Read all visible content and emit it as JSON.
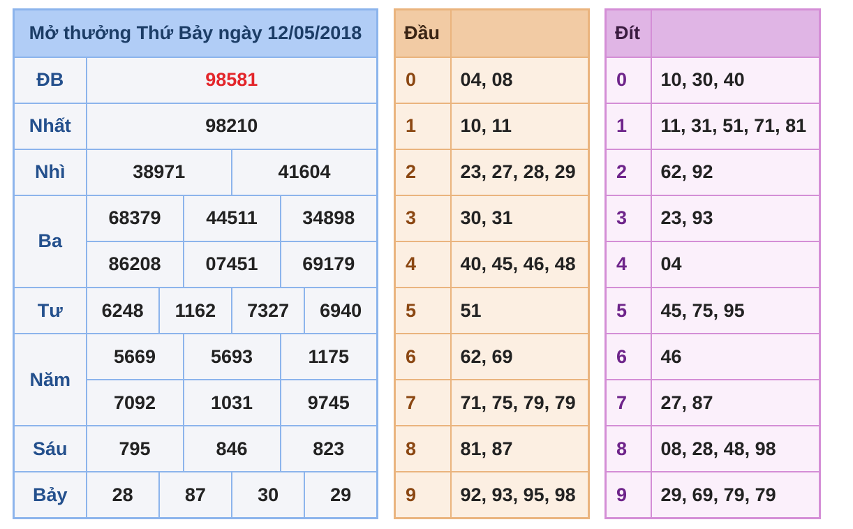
{
  "results": {
    "title": "Mở thưởng Thứ Bảy ngày 12/05/2018",
    "colors": {
      "accent_border": "#8cb4ec",
      "special_prize": "#e3262b",
      "label": "#24508d"
    },
    "rows": [
      {
        "label": "ĐB",
        "values": [
          "98581"
        ]
      },
      {
        "label": "Nhất",
        "values": [
          "98210"
        ]
      },
      {
        "label": "Nhì",
        "values": [
          "38971",
          "41604"
        ]
      },
      {
        "label": "Ba",
        "values": [
          "68379",
          "44511",
          "34898",
          "86208",
          "07451",
          "69179"
        ]
      },
      {
        "label": "Tư",
        "values": [
          "6248",
          "1162",
          "7327",
          "6940"
        ]
      },
      {
        "label": "Năm",
        "values": [
          "5669",
          "5693",
          "1175",
          "7092",
          "1031",
          "9745"
        ]
      },
      {
        "label": "Sáu",
        "values": [
          "795",
          "846",
          "823"
        ]
      },
      {
        "label": "Bảy",
        "values": [
          "28",
          "87",
          "30",
          "29"
        ]
      }
    ]
  },
  "dau": {
    "header": "Đầu",
    "rows": [
      {
        "key": "0",
        "values": "04, 08"
      },
      {
        "key": "1",
        "values": "10, 11"
      },
      {
        "key": "2",
        "values": "23, 27, 28, 29"
      },
      {
        "key": "3",
        "values": "30, 31"
      },
      {
        "key": "4",
        "values": "40, 45, 46, 48"
      },
      {
        "key": "5",
        "values": "51"
      },
      {
        "key": "6",
        "values": "62, 69"
      },
      {
        "key": "7",
        "values": "71, 75, 79, 79"
      },
      {
        "key": "8",
        "values": "81, 87"
      },
      {
        "key": "9",
        "values": "92, 93, 95, 98"
      }
    ]
  },
  "dit": {
    "header": "Đít",
    "rows": [
      {
        "key": "0",
        "values": "10, 30, 40"
      },
      {
        "key": "1",
        "values": "11, 31, 51, 71, 81"
      },
      {
        "key": "2",
        "values": "62, 92"
      },
      {
        "key": "3",
        "values": "23, 93"
      },
      {
        "key": "4",
        "values": "04"
      },
      {
        "key": "5",
        "values": "45, 75, 95"
      },
      {
        "key": "6",
        "values": "46"
      },
      {
        "key": "7",
        "values": "27, 87"
      },
      {
        "key": "8",
        "values": "08, 28, 48, 98"
      },
      {
        "key": "9",
        "values": "29, 69, 79, 79"
      }
    ]
  }
}
